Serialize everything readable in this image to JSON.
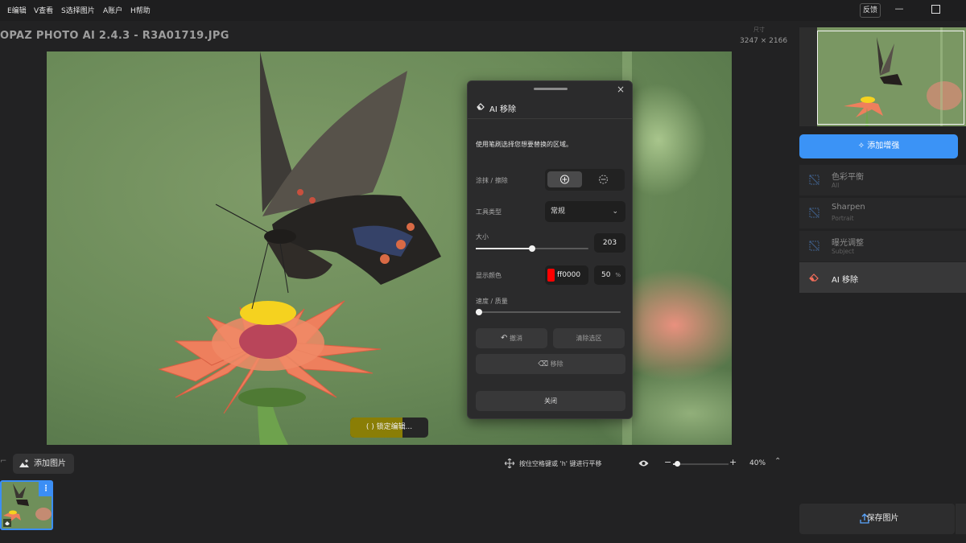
{
  "menubar": {
    "items": [
      "E编辑",
      "V查看",
      "S选择图片",
      "A账户",
      "H帮助"
    ],
    "feedback": "反馈",
    "minimize": "—"
  },
  "document": {
    "title": "OPAZ PHOTO AI 2.4.3 - R3A01719.JPG",
    "size_label": "尺寸",
    "size_value": "3247 × 2166"
  },
  "canvas": {
    "lock_edit": "(  )  锁定编辑...",
    "lock_progress": 0.67
  },
  "ai_remove_panel": {
    "title": "AI 移除",
    "close": "×",
    "description": "使用笔刷选择您想要替换的区域。",
    "paint_erase_label": "涂抹 / 擦除",
    "tool_type_label": "工具类型",
    "tool_type_value": "常规",
    "size_label": "大小",
    "size_value": "203",
    "size_fraction": 0.5,
    "display_color_label": "显示颜色",
    "display_color_hex": "ff0000",
    "display_color_opacity": "50",
    "percent": "%",
    "speed_quality_label": "速度 / 质量",
    "speed_quality_fraction": 0.0,
    "undo": "撤消",
    "clear_selection": "清除选区",
    "remove": "移除",
    "close_button": "关闭"
  },
  "bottom_bar": {
    "add_photo": "添加图片",
    "pan_hint": "按住空格键或 'h' 键进行平移",
    "zoom_value": "40%",
    "zoom_fraction": 0.08,
    "zoom_minus": "−",
    "zoom_plus": "+",
    "chevron": "⌃"
  },
  "filmstrip": {
    "menu": "⋮"
  },
  "sidebar": {
    "add_enhancement": "添加增强",
    "enhancements": [
      {
        "name": "色彩平衡",
        "sub": "All"
      },
      {
        "name": "Sharpen",
        "sub": "Portrait"
      },
      {
        "name": "曝光调整",
        "sub": "Subject"
      }
    ],
    "active_enhancement": "AI 移除",
    "save": "保存图片"
  },
  "colors": {
    "accent": "#3b93f6",
    "lock_fill": "#8a7e06",
    "eraser_icon": "#f26d5a",
    "display_color": "#ff0000"
  }
}
